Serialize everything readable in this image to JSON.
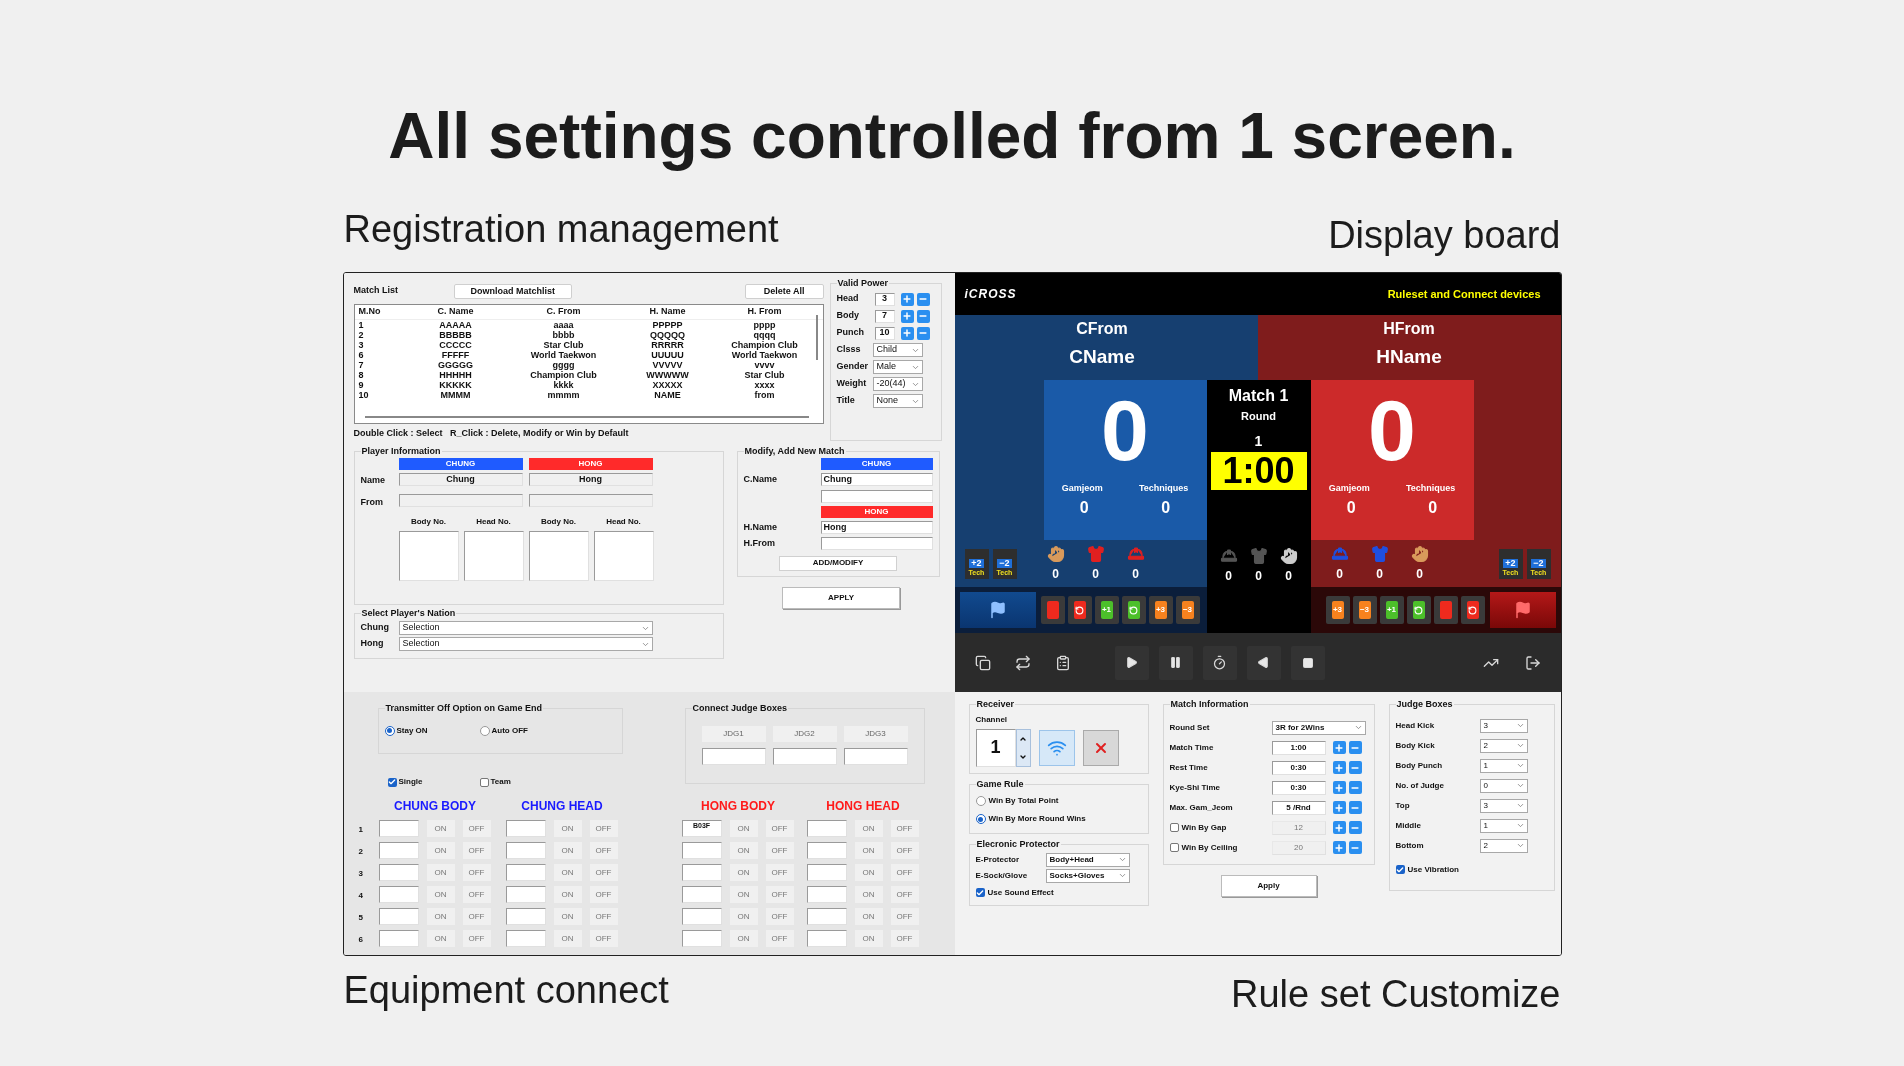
{
  "headline": "All settings controlled from 1 screen.",
  "captions": {
    "registration": "Registration management",
    "display": "Display board",
    "equipment": "Equipment connect",
    "ruleset": "Rule set Customize"
  },
  "registration": {
    "match_list": {
      "label": "Match List",
      "download_button": "Download Matchlist",
      "delete_button": "Delete All",
      "columns": [
        "M.No",
        "C. Name",
        "C. From",
        "H. Name",
        "H. From"
      ],
      "rows": [
        [
          "1",
          "AAAAA",
          "aaaa",
          "PPPPP",
          "pppp"
        ],
        [
          "2",
          "BBBBB",
          "bbbb",
          "QQQQQ",
          "qqqq"
        ],
        [
          "3",
          "CCCCC",
          "Star Club",
          "RRRRR",
          "Champion Club"
        ],
        [
          "6",
          "FFFFF",
          "World Taekwon",
          "UUUUU",
          "World Taekwon"
        ],
        [
          "7",
          "GGGGG",
          "gggg",
          "VVVVV",
          "vvvv"
        ],
        [
          "8",
          "HHHHH",
          "Champion Club",
          "WWWWW",
          "Star Club"
        ],
        [
          "9",
          "KKKKK",
          "kkkk",
          "XXXXX",
          "xxxx"
        ],
        [
          "10",
          "MMMM",
          "mmmm",
          "NAME",
          "from"
        ]
      ]
    },
    "hint": "Double Click : Select   R_Click : Delete, Modify or Win by Default",
    "valid_power": {
      "title": "Valid Power",
      "counters": [
        {
          "label": "Head",
          "value": "3"
        },
        {
          "label": "Body",
          "value": "7"
        },
        {
          "label": "Punch",
          "value": "10"
        }
      ],
      "selects": [
        {
          "label": "Clsss",
          "value": "Child"
        },
        {
          "label": "Gender",
          "value": "Male"
        },
        {
          "label": "Weight",
          "value": "-20(44)"
        },
        {
          "label": "Title",
          "value": "None"
        }
      ]
    },
    "player_info": {
      "title": "Player Information",
      "chung_header": "CHUNG",
      "hong_header": "HONG",
      "name_label": "Name",
      "from_label": "From",
      "chung_name": "Chung",
      "hong_name": "Hong",
      "number_labels": [
        "Body No.",
        "Head No.",
        "Body No.",
        "Head No."
      ]
    },
    "nation": {
      "title": "Select Player's Nation",
      "rows": [
        {
          "label": "Chung",
          "value": "Selection"
        },
        {
          "label": "Hong",
          "value": "Selection"
        }
      ]
    },
    "modify": {
      "title": "Modify, Add New Match",
      "chung_header": "CHUNG",
      "c_name_label": "C.Name",
      "c_name_value": "Chung",
      "hong_header": "HONG",
      "h_name_label": "H.Name",
      "h_name_value": "Hong",
      "h_from_label": "H.From",
      "add_button": "ADD/MODIFY",
      "apply_button": "APPLY"
    }
  },
  "equipment": {
    "transmitter": {
      "title": "Transmitter Off Option on Game End",
      "options": [
        {
          "label": "Stay ON",
          "selected": true
        },
        {
          "label": "Auto OFF",
          "selected": false
        }
      ]
    },
    "modes": [
      {
        "label": "Single",
        "checked": true
      },
      {
        "label": "Team",
        "checked": false
      }
    ],
    "judges": {
      "title": "Connect Judge Boxes",
      "buttons": [
        "JDG1",
        "JDG2",
        "JDG3"
      ]
    },
    "row_labels": [
      "1",
      "2",
      "3",
      "4",
      "5",
      "6"
    ],
    "groups": [
      {
        "title": "CHUNG BODY",
        "color": "#1a1aff",
        "rows": [
          {
            "on": "ON",
            "off": "OFF"
          },
          {
            "on": "ON",
            "off": "OFF"
          },
          {
            "on": "ON",
            "off": "OFF"
          },
          {
            "on": "ON",
            "off": "OFF"
          },
          {
            "on": "ON",
            "off": "OFF"
          },
          {
            "on": "ON",
            "off": "OFF"
          }
        ]
      },
      {
        "title": "CHUNG HEAD",
        "color": "#1a1aff",
        "rows": [
          {
            "on": "ON",
            "off": "OFF"
          },
          {
            "on": "ON",
            "off": "OFF"
          },
          {
            "on": "ON",
            "off": "OFF"
          },
          {
            "on": "ON",
            "off": "OFF"
          },
          {
            "on": "ON",
            "off": "OFF"
          },
          {
            "on": "ON",
            "off": "OFF"
          }
        ]
      },
      {
        "title": "HONG BODY",
        "color": "#ff1a1a",
        "rows": [
          {
            "value": "B03F",
            "on": "ON",
            "off": "OFF"
          },
          {
            "on": "ON",
            "off": "OFF"
          },
          {
            "on": "ON",
            "off": "OFF"
          },
          {
            "on": "ON",
            "off": "OFF"
          },
          {
            "on": "ON",
            "off": "OFF"
          },
          {
            "on": "ON",
            "off": "OFF"
          }
        ]
      },
      {
        "title": "HONG HEAD",
        "color": "#ff1a1a",
        "rows": [
          {
            "on": "ON",
            "off": "OFF"
          },
          {
            "on": "ON",
            "off": "OFF"
          },
          {
            "on": "ON",
            "off": "OFF"
          },
          {
            "on": "ON",
            "off": "OFF"
          },
          {
            "on": "ON",
            "off": "OFF"
          },
          {
            "on": "ON",
            "off": "OFF"
          }
        ]
      }
    ]
  },
  "display": {
    "logo": "iCROSS",
    "header_link": "Ruleset and Connect devices",
    "sides": [
      {
        "from": "CFrom",
        "name": "CName",
        "score": "0",
        "gamjeom_label": "Gamjeom",
        "gamjeom": "0",
        "techniques_label": "Techniques",
        "techniques": "0",
        "tech_buttons": [
          {
            "value": "+2",
            "label": "Tech"
          },
          {
            "value": "−2",
            "label": "Tech"
          }
        ],
        "gear": [
          {
            "kind": "fist",
            "color": "#d99a5b",
            "count": "0"
          },
          {
            "kind": "vest",
            "color": "#e02020",
            "count": "0"
          },
          {
            "kind": "helmet",
            "color": "#e02020",
            "count": "0"
          }
        ],
        "cards": [
          {
            "kind": "card",
            "color": "#ee2a1e"
          },
          {
            "kind": "undo",
            "color": "#ee2a1e"
          },
          {
            "kind": "card",
            "color": "#4cc02a",
            "label": "+1"
          },
          {
            "kind": "undo",
            "color": "#4cc02a"
          },
          {
            "kind": "card",
            "color": "#f7821e",
            "label": "+3"
          },
          {
            "kind": "card",
            "color": "#f7821e",
            "label": "−3"
          }
        ]
      },
      {
        "from": "HFrom",
        "name": "HName",
        "score": "0",
        "gamjeom_label": "Gamjeom",
        "gamjeom": "0",
        "techniques_label": "Techniques",
        "techniques": "0",
        "tech_buttons": [
          {
            "value": "+2",
            "label": "Tech"
          },
          {
            "value": "−2",
            "label": "Tech"
          }
        ],
        "gear": [
          {
            "kind": "helmet",
            "color": "#1f4fe0",
            "count": "0"
          },
          {
            "kind": "vest",
            "color": "#1f4fe0",
            "count": "0"
          },
          {
            "kind": "fist",
            "color": "#d99a5b",
            "count": "0"
          }
        ],
        "cards": [
          {
            "kind": "card",
            "color": "#f7821e",
            "label": "+3"
          },
          {
            "kind": "card",
            "color": "#f7821e",
            "label": "−3"
          },
          {
            "kind": "card",
            "color": "#4cc02a",
            "label": "+1"
          },
          {
            "kind": "undo",
            "color": "#4cc02a"
          },
          {
            "kind": "card",
            "color": "#ee2a1e"
          },
          {
            "kind": "undo",
            "color": "#ee2a1e"
          }
        ]
      }
    ],
    "match": {
      "title": "Match 1",
      "round_label": "Round",
      "round": "1",
      "clock": "1:00"
    },
    "center_gear": [
      {
        "kind": "helmet",
        "color": "#555555",
        "count": "0"
      },
      {
        "kind": "vest",
        "color": "#555555",
        "count": "0"
      },
      {
        "kind": "fist",
        "color": "#cccccc",
        "count": "0"
      }
    ]
  },
  "ruleset": {
    "receiver": {
      "title": "Receiver",
      "channel_label": "Channel",
      "channel": "1"
    },
    "game_rule": {
      "title": "Game Rule",
      "options": [
        {
          "label": "Win By Total Point",
          "selected": false
        },
        {
          "label": "Win By More Round Wins",
          "selected": true
        }
      ]
    },
    "protector": {
      "title": "Elecronic Protector",
      "selects": [
        {
          "label": "E-Protector",
          "value": "Body+Head"
        },
        {
          "label": "E-Sock/Glove",
          "value": "Socks+Gloves"
        }
      ],
      "sound": {
        "label": "Use Sound Effect",
        "checked": true
      }
    },
    "match_info": {
      "title": "Match Information",
      "round_set": {
        "label": "Round Set",
        "value": "3R for 2Wins"
      },
      "rows": [
        {
          "kind": "field",
          "label": "Match Time",
          "value": "1:00"
        },
        {
          "kind": "field",
          "label": "Rest Time",
          "value": "0:30"
        },
        {
          "kind": "field",
          "label": "Kye-Shi Time",
          "value": "0:30"
        },
        {
          "kind": "field",
          "label": "Max. Gam_Jeom",
          "value": "5 /Rnd"
        },
        {
          "kind": "check",
          "label": "Win By Gap",
          "value": "12",
          "checked": false,
          "disabled": true
        },
        {
          "kind": "check",
          "label": "Win By Ceiling",
          "value": "20",
          "checked": false,
          "disabled": true
        }
      ],
      "apply_button": "Apply"
    },
    "judge_boxes": {
      "title": "Judge Boxes",
      "selects": [
        {
          "label": "Head Kick",
          "value": "3"
        },
        {
          "label": "Body Kick",
          "value": "2"
        },
        {
          "label": "Body Punch",
          "value": "1"
        },
        {
          "label": "No. of Judge",
          "value": "0"
        },
        {
          "label": "Top",
          "value": "3"
        },
        {
          "label": "Middle",
          "value": "1"
        },
        {
          "label": "Bottom",
          "value": "2"
        }
      ],
      "vibration": {
        "label": "Use Vibration",
        "checked": true
      }
    }
  }
}
